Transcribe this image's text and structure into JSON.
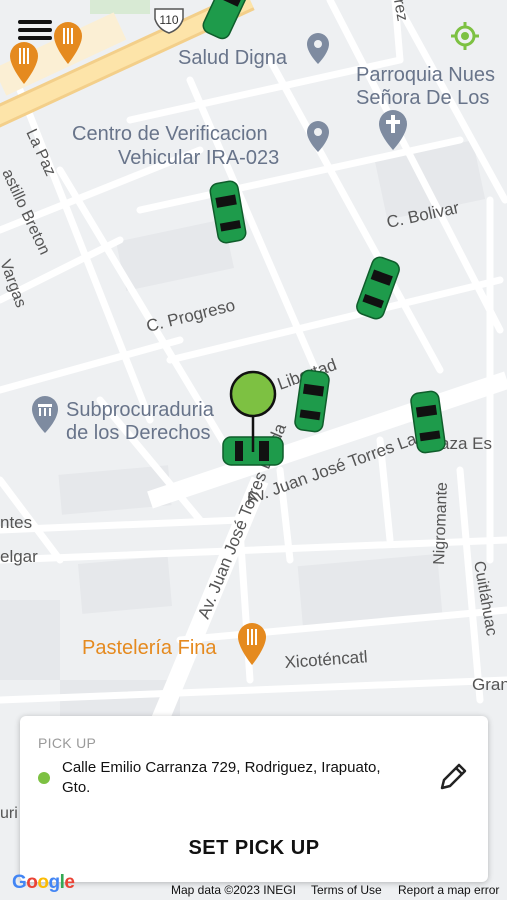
{
  "map": {
    "streets": [
      "110",
      "La Paz",
      "astillo Breton",
      "Vargas",
      "C. Progreso",
      "Libertad",
      "C. Bolivar",
      "Av. Juan José Torres Landa",
      "Nigromante",
      "Cuitláhuac",
      "Xicoténcatl",
      "ntes",
      "elgar",
      "Gran",
      "aza Es",
      "rez",
      "uri"
    ],
    "places": [
      "Salud Digna",
      "Parroquia Nues",
      "Señora De Los",
      "Centro de Verificacion",
      "Vehicular IRA-023",
      "Subprocuraduria",
      "de los Derechos",
      "Pastelería Fina"
    ]
  },
  "pickup": {
    "title": "PICK UP",
    "address_line1": "Calle Emilio Carranza 729, Rodriguez, Irapuato,",
    "address_line2": "Gto.",
    "set_button": "SET PICK UP"
  },
  "attribution": {
    "google": "Google",
    "map_data": "Map data ©2023 INEGI",
    "terms": "Terms of Use",
    "report": "Report a map error"
  },
  "colors": {
    "accent": "#7dc142",
    "car": "#1e9b4b",
    "poi": "#e58a1f",
    "place_pin": "#7e8ba0"
  },
  "icons": {
    "menu": "hamburger-icon",
    "locate": "my-location-icon",
    "edit": "pencil-icon"
  }
}
